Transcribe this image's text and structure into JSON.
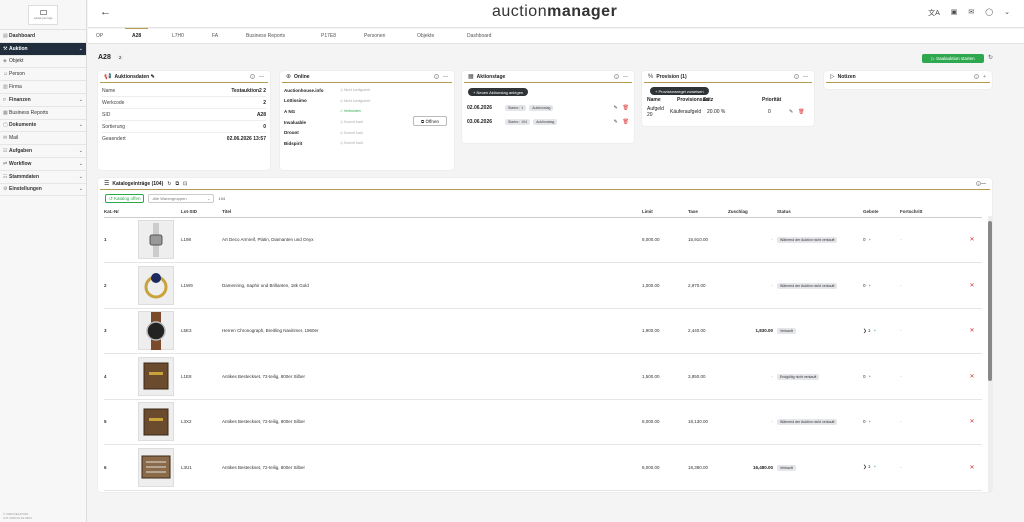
{
  "sidebar": {
    "logo_text": "upload your logo",
    "items": [
      {
        "label": "Dashboard",
        "icon": "chart-icon",
        "chev": ""
      },
      {
        "label": "Auktion",
        "icon": "gavel-icon",
        "chev": "⌄"
      },
      {
        "label": "Objekt",
        "icon": "cube-icon",
        "chev": ""
      },
      {
        "label": "Person",
        "icon": "person-icon",
        "chev": ""
      },
      {
        "label": "Firma",
        "icon": "building-icon",
        "chev": ""
      },
      {
        "label": "Finanzen",
        "icon": "money-icon",
        "chev": "⌄"
      },
      {
        "label": "Business Reports",
        "icon": "report-icon",
        "chev": ""
      },
      {
        "label": "Dokumente",
        "icon": "document-icon",
        "chev": "⌄"
      },
      {
        "label": "Mail",
        "icon": "mail-icon",
        "chev": ""
      },
      {
        "label": "Aufgaben",
        "icon": "task-icon",
        "chev": "⌄"
      },
      {
        "label": "Workflow",
        "icon": "workflow-icon",
        "chev": "⌄"
      },
      {
        "label": "Stammdaten",
        "icon": "database-icon",
        "chev": "⌄"
      },
      {
        "label": "Einstellungen",
        "icon": "gear-icon",
        "chev": "⌄"
      }
    ],
    "footer_line1": "© 2026 RELATION",
    "footer_line2": "V47.2026.02.19.0924"
  },
  "topbar": {
    "brand_light": "auction",
    "brand_bold": "manager"
  },
  "tabs": [
    "OP",
    "A28",
    "L7H0",
    "FA",
    "Business Reports",
    "P17E8",
    "Personen",
    "Objekte",
    "Dashboard"
  ],
  "page": {
    "title": "A28",
    "count": "2",
    "start_button": "Saalauktion starten"
  },
  "auktionsdaten": {
    "title": "Auktionsdaten",
    "rows": [
      {
        "k": "Name",
        "v": "Testauktion2 2"
      },
      {
        "k": "Werkcode",
        "v": "2"
      },
      {
        "k": "SID",
        "v": "A28"
      },
      {
        "k": "Sortierung",
        "v": "0"
      },
      {
        "k": "Geaendert",
        "v": "02.06.2026 13:57"
      }
    ]
  },
  "online": {
    "title": "Online",
    "rows": [
      {
        "k": "Auctionhouse.info",
        "v": "Nicht konfiguriert",
        "ok": false
      },
      {
        "k": "Lottissimo",
        "v": "Nicht konfiguriert",
        "ok": false
      },
      {
        "k": "A NG",
        "v": "Verbunden",
        "ok": true
      },
      {
        "k": "Invaluable",
        "v": "Kommt bald",
        "ok": false
      },
      {
        "k": "Drouot",
        "v": "Kommt bald",
        "ok": false
      },
      {
        "k": "Bidspirit",
        "v": "Kommt bald",
        "ok": false
      }
    ],
    "open_button": "Öffnen"
  },
  "aktionstage": {
    "title": "Aktionstage",
    "new_button": "Neuen Aktionstag anlegen",
    "rows": [
      {
        "date": "02.06.2026",
        "starts": "Startnr.: 1",
        "type": "Auktionstag"
      },
      {
        "date": "03.06.2026",
        "starts": "Startnr.: 104",
        "type": "Auktionstag"
      }
    ]
  },
  "provision": {
    "title": "Provision (1)",
    "assign_button": "Provisionsregel zuweisen",
    "headers": [
      "Name",
      "Provisionsart",
      "Satz",
      "Priorität"
    ],
    "row": {
      "name": "Aufgeld 20",
      "art": "Käuferaufgeld",
      "satz": "20.00 %",
      "prio": "0"
    }
  },
  "notizen": {
    "title": "Notizen"
  },
  "katalog": {
    "title": "Katalogeinträge (104)",
    "filter_button": "Katalog offen",
    "select_placeholder": "Alle Warengruppen",
    "count": "104",
    "headers": [
      "Kat.-Nr",
      "",
      "Lot-SID",
      "Titel",
      "Limit",
      "Taxe",
      "Zuschlag",
      "Status",
      "Gebote",
      "Fortschritt"
    ],
    "rows": [
      {
        "nr": "1",
        "img": "watch-icon",
        "sid": "L198",
        "title": "Art Deco Armreif, Platin, Diamanten und Onyx",
        "limit": "8,000.00",
        "taxe": "15,910.00",
        "zuschlag": "-",
        "status": "Während der Auktion nicht verkauft",
        "gebote": "0",
        "fort": "-"
      },
      {
        "nr": "2",
        "img": "ring-icon",
        "sid": "L1W9",
        "title": "Damenring, Saphir und Brillanten, 18k Gold",
        "limit": "1,000.00",
        "taxe": "2,970.00",
        "zuschlag": "-",
        "status": "Während der Auktion nicht verkauft",
        "gebote": "0",
        "fort": "-"
      },
      {
        "nr": "3",
        "img": "chronograph-icon",
        "sid": "L5E3",
        "title": "Herren Chronograph, Breitling Navitimer, 1960er",
        "limit": "1,900.00",
        "taxe": "2,440.00",
        "zuschlag": "1,830.00",
        "status": "Verkauft",
        "gebote": "1",
        "fort": "-"
      },
      {
        "nr": "4",
        "img": "box-icon",
        "sid": "L1E8",
        "title": "Antikes Besteckset, 72-teilig, 800er Silber",
        "limit": "1,500.00",
        "taxe": "3,850.00",
        "zuschlag": "-",
        "status": "Endgültig nicht verkauft",
        "gebote": "0",
        "fort": "-"
      },
      {
        "nr": "5",
        "img": "box-icon",
        "sid": "L3X2",
        "title": "Antikes Besteckset, 72-teilig, 800er Silber",
        "limit": "8,000.00",
        "taxe": "18,130.00",
        "zuschlag": "-",
        "status": "Während der Auktion nicht verkauft",
        "gebote": "0",
        "fort": "-"
      },
      {
        "nr": "6",
        "img": "cutlery-box-icon",
        "sid": "L3U1",
        "title": "Antikes Besteckset, 72-teilig, 800er Silber",
        "limit": "8,000.00",
        "taxe": "18,380.00",
        "zuschlag": "16,480.00",
        "status": "Verkauft",
        "gebote": "1",
        "fort": "-"
      }
    ]
  },
  "colors": {
    "accent": "#b59a4c",
    "green": "#2ea84f",
    "sidebar_active": "#1f2d3d",
    "danger": "#d33333"
  }
}
